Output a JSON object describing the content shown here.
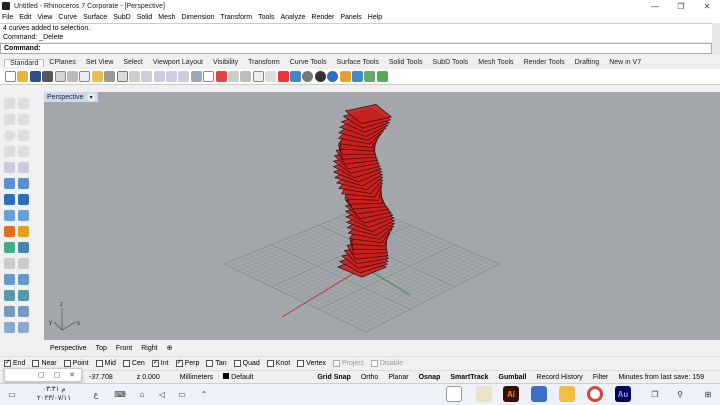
{
  "window": {
    "title": "Untitled - Rhinoceros 7 Corporate - [Perspective]",
    "min": "—",
    "max": "❐",
    "close": "✕"
  },
  "menu": [
    "File",
    "Edit",
    "View",
    "Curve",
    "Surface",
    "SubD",
    "Solid",
    "Mesh",
    "Dimension",
    "Transform",
    "Tools",
    "Analyze",
    "Render",
    "Panels",
    "Help"
  ],
  "command": {
    "history1": "4 curves added to selection.",
    "history2": "Command: _Delete",
    "prompt": "Command:"
  },
  "tabs": [
    "Standard",
    "CPlanes",
    "Set View",
    "Select",
    "Viewport Layout",
    "Visibility",
    "Transform",
    "Curve Tools",
    "Surface Tools",
    "Solid Tools",
    "SubD Tools",
    "Mesh Tools",
    "Render Tools",
    "Drafting",
    "New in V7"
  ],
  "active_tab": "Standard",
  "viewport": {
    "title": "Perspective",
    "dropdown": "▾",
    "axis_x": "x",
    "axis_y": "y",
    "axis_z": "z"
  },
  "viewport_tabs": [
    "Perspective",
    "Top",
    "Front",
    "Right",
    "⊕"
  ],
  "osnaps": [
    {
      "label": "End",
      "checked": true
    },
    {
      "label": "Near",
      "checked": false
    },
    {
      "label": "Point",
      "checked": false
    },
    {
      "label": "Mid",
      "checked": false
    },
    {
      "label": "Cen",
      "checked": false
    },
    {
      "label": "Int",
      "checked": true
    },
    {
      "label": "Perp",
      "checked": true
    },
    {
      "label": "Tan",
      "checked": false
    },
    {
      "label": "Quad",
      "checked": false
    },
    {
      "label": "Knot",
      "checked": false
    },
    {
      "label": "Vertex",
      "checked": false
    },
    {
      "label": "Project",
      "checked": false,
      "disabled": true
    },
    {
      "label": "Disable",
      "checked": false,
      "disabled": true
    }
  ],
  "status": {
    "y": "-37.708",
    "z": "z 0.000",
    "units": "Millimeters",
    "layer": "Default",
    "grid_snap": "Grid Snap",
    "ortho": "Ortho",
    "planar": "Planar",
    "osnap": "Osnap",
    "smarttrack": "SmartTrack",
    "gumball": "Gumball",
    "record_history": "Record History",
    "filter": "Filter",
    "save_info": "Minutes from last save: 159"
  },
  "popup": {
    "a": "▢",
    "b": "▢",
    "c": "✕"
  },
  "taskbar": {
    "time": "م ٠٣:٣١",
    "date": "٢٠٢٣/٠٧/١١",
    "lang": "ع"
  },
  "colors": {
    "viewport_bg": "#a3a6aa",
    "tower_fill": "#c8201f",
    "tower_stroke": "#3a0505",
    "x_axis": "#c03030",
    "y_axis": "#2f8f2f"
  }
}
